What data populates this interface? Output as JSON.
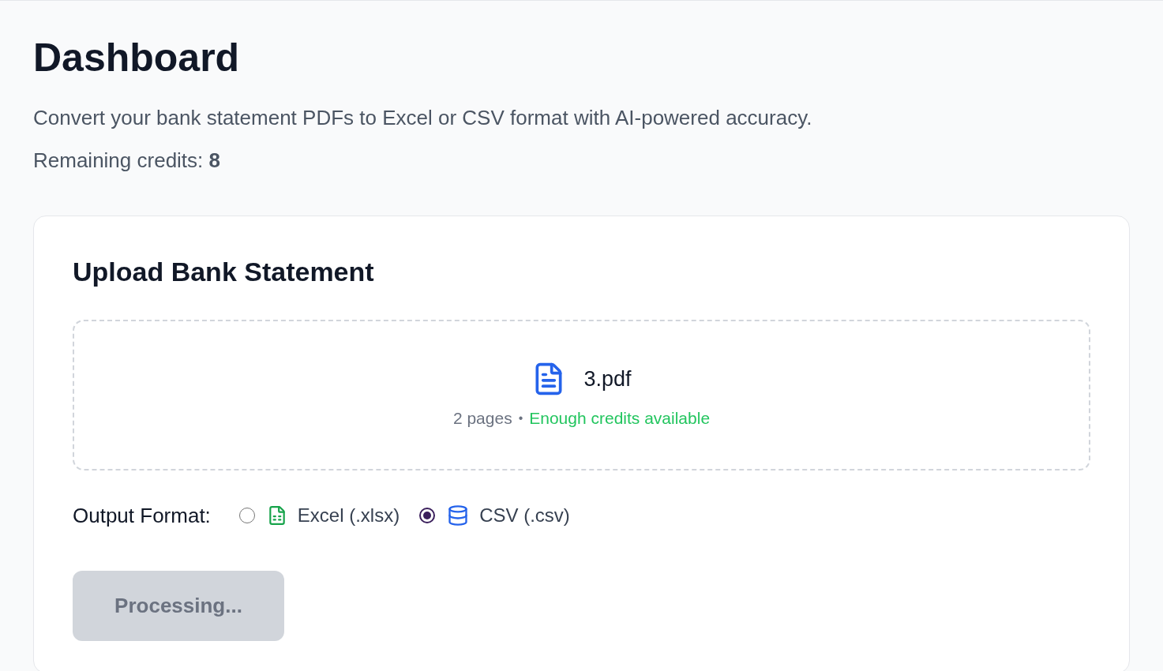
{
  "page": {
    "title": "Dashboard",
    "description": "Convert your bank statement PDFs to Excel or CSV format with AI-powered accuracy.",
    "credits": "Remaining credits: **8**"
  },
  "upload_card": {
    "title": "Upload Bank Statement",
    "file": {
      "name": "3.pdf",
      "pages": "2 pages",
      "separator": "•",
      "status": "Enough credits available"
    },
    "output_format": {
      "label": "Output Format:",
      "options": [
        {
          "kind": "excel",
          "label": "Excel (.xlsx)",
          "selected": false
        },
        {
          "kind": "csv",
          "label": "CSV (.csv)",
          "selected": true
        }
      ]
    },
    "submit": {
      "label": "Processing...",
      "disabled": true
    }
  }
}
